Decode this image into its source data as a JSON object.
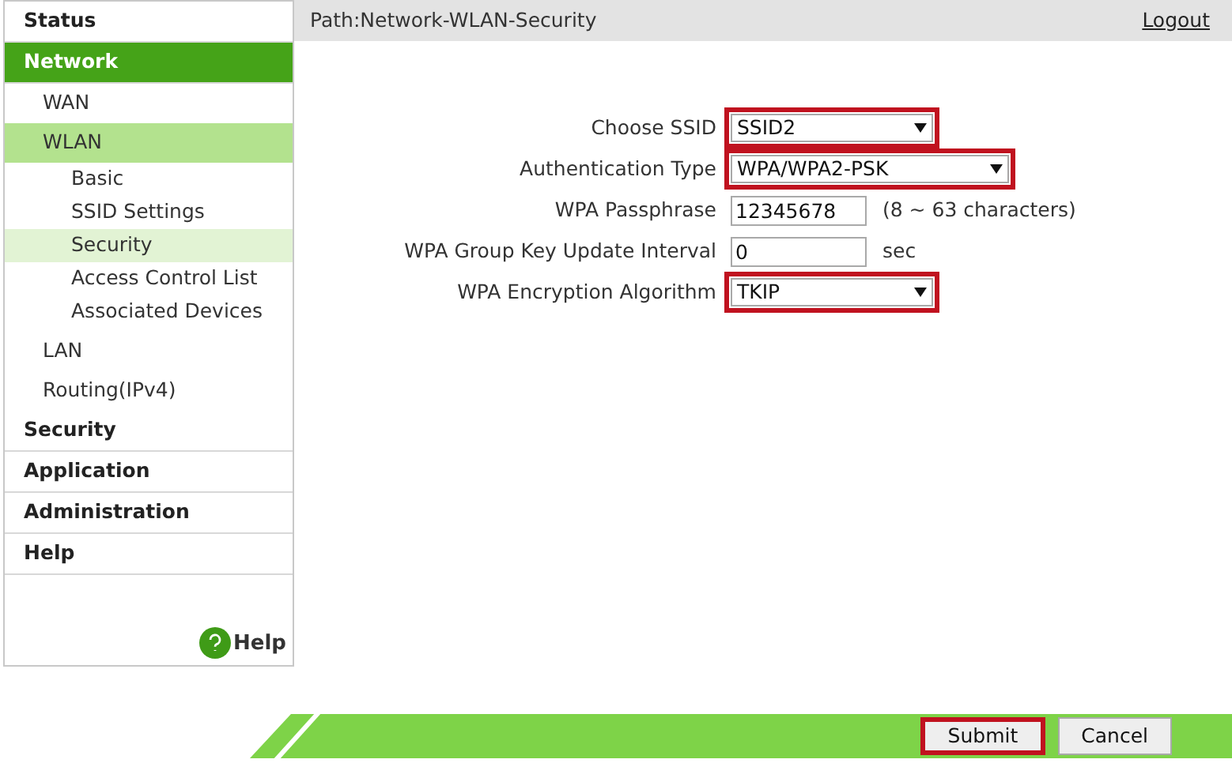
{
  "sidebar": {
    "items": [
      {
        "label": "Status",
        "selected": false
      },
      {
        "label": "Network",
        "selected": true,
        "children": [
          {
            "label": "WAN",
            "selected": false
          },
          {
            "label": "WLAN",
            "selected": true,
            "children": [
              {
                "label": "Basic",
                "selected": false
              },
              {
                "label": "SSID Settings",
                "selected": false
              },
              {
                "label": "Security",
                "selected": true
              },
              {
                "label": "Access Control List",
                "selected": false
              },
              {
                "label": "Associated Devices",
                "selected": false
              }
            ]
          },
          {
            "label": "LAN",
            "selected": false
          },
          {
            "label": "Routing(IPv4)",
            "selected": false
          }
        ]
      },
      {
        "label": "Security",
        "selected": false
      },
      {
        "label": "Application",
        "selected": false
      },
      {
        "label": "Administration",
        "selected": false
      },
      {
        "label": "Help",
        "selected": false
      }
    ],
    "help_link": "Help"
  },
  "header": {
    "path": "Path:Network-WLAN-Security",
    "logout": "Logout"
  },
  "form": {
    "fields": [
      {
        "kind": "select",
        "label": "Choose SSID",
        "value": "SSID2",
        "highlighted": true
      },
      {
        "kind": "select",
        "label": "Authentication Type",
        "value": "WPA/WPA2-PSK",
        "highlighted": true
      },
      {
        "kind": "text",
        "label": "WPA Passphrase",
        "value": "12345678",
        "suffix": "(8 ~ 63 characters)",
        "highlighted": false
      },
      {
        "kind": "text",
        "label": "WPA Group Key Update Interval",
        "value": "0",
        "suffix": "sec",
        "highlighted": false
      },
      {
        "kind": "select",
        "label": "WPA Encryption Algorithm",
        "value": "TKIP",
        "highlighted": true
      }
    ]
  },
  "buttons": [
    {
      "label": "Submit",
      "highlighted": true
    },
    {
      "label": "Cancel",
      "highlighted": false
    }
  ]
}
